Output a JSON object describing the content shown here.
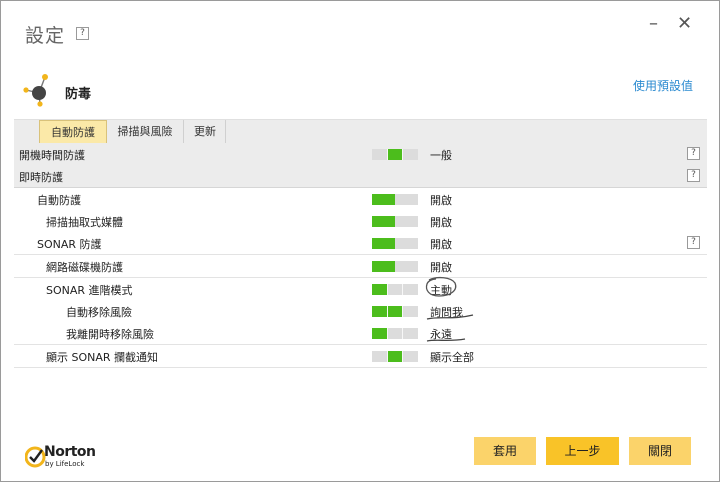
{
  "window": {
    "title": "設定",
    "help_glyph": "?",
    "minimize_glyph": "–",
    "close_glyph": "✕"
  },
  "section": {
    "title": "防毒",
    "use_defaults": "使用預設值"
  },
  "tabs": [
    {
      "label": "自動防護",
      "active": true
    },
    {
      "label": "掃描與風險",
      "active": false
    },
    {
      "label": "更新",
      "active": false
    }
  ],
  "rows": [
    {
      "label": "開機時間防護",
      "value": "一般",
      "help": "?"
    },
    {
      "label": "即時防護",
      "help": "?"
    },
    {
      "label": "自動防護",
      "value": "開啟"
    },
    {
      "label": "掃描抽取式媒體",
      "value": "開啟"
    },
    {
      "label": "SONAR 防護",
      "value": "開啟",
      "help": "?"
    },
    {
      "label": "網路磁碟機防護",
      "value": "開啟"
    },
    {
      "label": "SONAR 進階模式",
      "value": "主動"
    },
    {
      "label": "自動移除風險",
      "value": "詢問我"
    },
    {
      "label": "我離開時移除風險",
      "value": "永遠"
    },
    {
      "label": "顯示 SONAR 攔截通知",
      "value": "顯示全部"
    }
  ],
  "sliders": {
    "boot_protection_level": 0.5,
    "auto_protect_level": 0.5,
    "removable_media_level": 0.5,
    "sonar_protection_level": 0.5,
    "network_drive_level": 0.5,
    "sonar_advanced_level": 0.33,
    "auto_remove_level": 0.66,
    "remove_away_level": 0.33,
    "sonar_notify_level": 0.5
  },
  "logo": {
    "name": "Norton",
    "sub": "by LifeLock"
  },
  "buttons": {
    "apply": "套用",
    "back": "上一步",
    "close": "關閉"
  },
  "colors": {
    "accent_yellow": "#f9c328",
    "slider_green": "#4cbd1c",
    "link_blue": "#2a8ad0"
  }
}
